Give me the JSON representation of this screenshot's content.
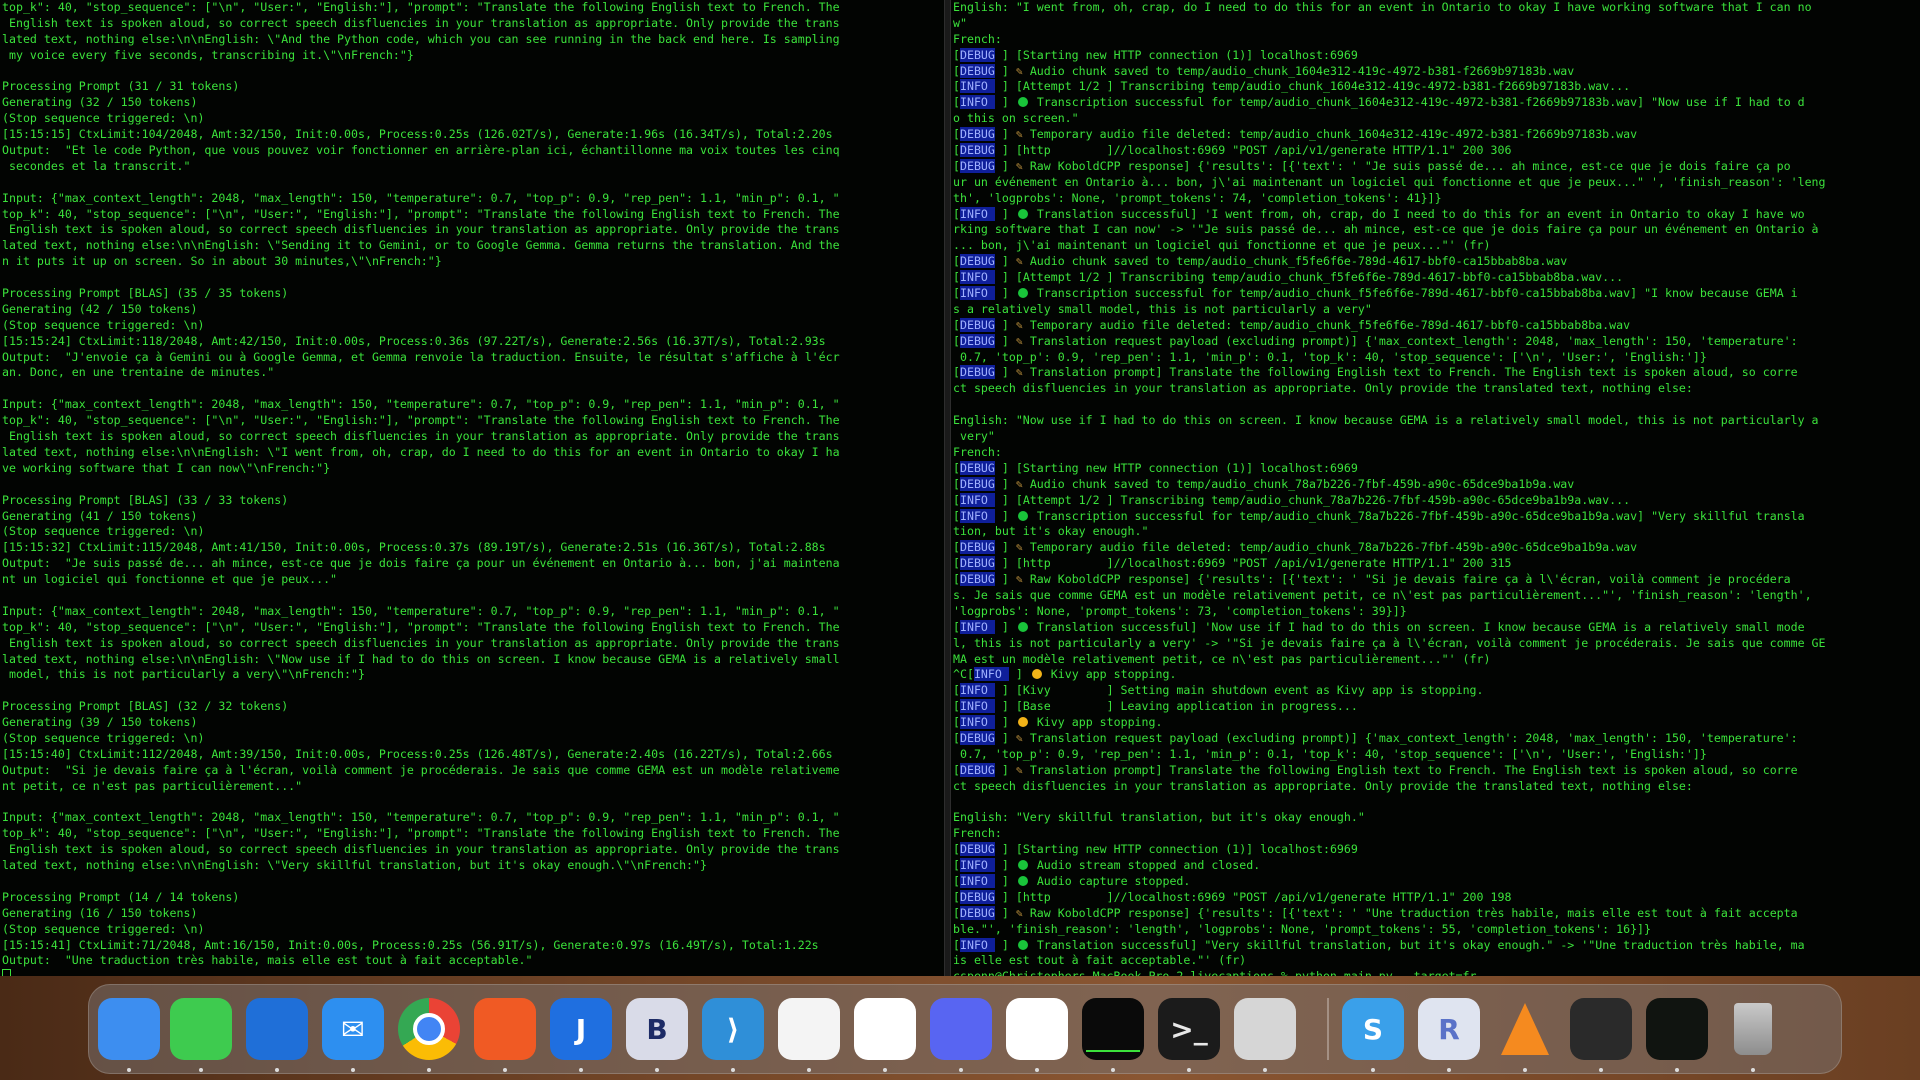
{
  "left_terminal": {
    "lines": [
      "top_k\": 40, \"stop_sequence\": [\"\\n\", \"User:\", \"English:\"], \"prompt\": \"Translate the following English text to French. The",
      " English text is spoken aloud, so correct speech disfluencies in your translation as appropriate. Only provide the trans",
      "lated text, nothing else:\\n\\nEnglish: \\\"And the Python code, which you can see running in the back end here. Is sampling",
      " my voice every five seconds, transcribing it.\\\"\\nFrench:\"}",
      "",
      "Processing Prompt (31 / 31 tokens)",
      "Generating (32 / 150 tokens)",
      "(Stop sequence triggered: \\n)",
      "[15:15:15] CtxLimit:104/2048, Amt:32/150, Init:0.00s, Process:0.25s (126.02T/s), Generate:1.96s (16.34T/s), Total:2.20s",
      "Output:  \"Et le code Python, que vous pouvez voir fonctionner en arrière-plan ici, échantillonne ma voix toutes les cinq",
      " secondes et la transcrit.\"",
      "",
      "Input: {\"max_context_length\": 2048, \"max_length\": 150, \"temperature\": 0.7, \"top_p\": 0.9, \"rep_pen\": 1.1, \"min_p\": 0.1, \"",
      "top_k\": 40, \"stop_sequence\": [\"\\n\", \"User:\", \"English:\"], \"prompt\": \"Translate the following English text to French. The",
      " English text is spoken aloud, so correct speech disfluencies in your translation as appropriate. Only provide the trans",
      "lated text, nothing else:\\n\\nEnglish: \\\"Sending it to Gemini, or to Google Gemma. Gemma returns the translation. And the",
      "n it puts it up on screen. So in about 30 minutes,\\\"\\nFrench:\"}",
      "",
      "Processing Prompt [BLAS] (35 / 35 tokens)",
      "Generating (42 / 150 tokens)",
      "(Stop sequence triggered: \\n)",
      "[15:15:24] CtxLimit:118/2048, Amt:42/150, Init:0.00s, Process:0.36s (97.22T/s), Generate:2.56s (16.37T/s), Total:2.93s",
      "Output:  \"J'envoie ça à Gemini ou à Google Gemma, et Gemma renvoie la traduction. Ensuite, le résultat s'affiche à l'écr",
      "an. Donc, en une trentaine de minutes.\"",
      "",
      "Input: {\"max_context_length\": 2048, \"max_length\": 150, \"temperature\": 0.7, \"top_p\": 0.9, \"rep_pen\": 1.1, \"min_p\": 0.1, \"",
      "top_k\": 40, \"stop_sequence\": [\"\\n\", \"User:\", \"English:\"], \"prompt\": \"Translate the following English text to French. The",
      " English text is spoken aloud, so correct speech disfluencies in your translation as appropriate. Only provide the trans",
      "lated text, nothing else:\\n\\nEnglish: \\\"I went from, oh, crap, do I need to do this for an event in Ontario to okay I ha",
      "ve working software that I can now\\\"\\nFrench:\"}",
      "",
      "Processing Prompt [BLAS] (33 / 33 tokens)",
      "Generating (41 / 150 tokens)",
      "(Stop sequence triggered: \\n)",
      "[15:15:32] CtxLimit:115/2048, Amt:41/150, Init:0.00s, Process:0.37s (89.19T/s), Generate:2.51s (16.36T/s), Total:2.88s",
      "Output:  \"Je suis passé de... ah mince, est-ce que je dois faire ça pour un événement en Ontario à... bon, j'ai maintena",
      "nt un logiciel qui fonctionne et que je peux...\"",
      "",
      "Input: {\"max_context_length\": 2048, \"max_length\": 150, \"temperature\": 0.7, \"top_p\": 0.9, \"rep_pen\": 1.1, \"min_p\": 0.1, \"",
      "top_k\": 40, \"stop_sequence\": [\"\\n\", \"User:\", \"English:\"], \"prompt\": \"Translate the following English text to French. The",
      " English text is spoken aloud, so correct speech disfluencies in your translation as appropriate. Only provide the trans",
      "lated text, nothing else:\\n\\nEnglish: \\\"Now use if I had to do this on screen. I know because GEMA is a relatively small",
      " model, this is not particularly a very\\\"\\nFrench:\"}",
      "",
      "Processing Prompt [BLAS] (32 / 32 tokens)",
      "Generating (39 / 150 tokens)",
      "(Stop sequence triggered: \\n)",
      "[15:15:40] CtxLimit:112/2048, Amt:39/150, Init:0.00s, Process:0.25s (126.48T/s), Generate:2.40s (16.22T/s), Total:2.66s",
      "Output:  \"Si je devais faire ça à l'écran, voilà comment je procéderais. Je sais que comme GEMA est un modèle relativeme",
      "nt petit, ce n'est pas particulièrement...\"",
      "",
      "Input: {\"max_context_length\": 2048, \"max_length\": 150, \"temperature\": 0.7, \"top_p\": 0.9, \"rep_pen\": 1.1, \"min_p\": 0.1, \"",
      "top_k\": 40, \"stop_sequence\": [\"\\n\", \"User:\", \"English:\"], \"prompt\": \"Translate the following English text to French. The",
      " English text is spoken aloud, so correct speech disfluencies in your translation as appropriate. Only provide the trans",
      "lated text, nothing else:\\n\\nEnglish: \\\"Very skillful translation, but it's okay enough.\\\"\\nFrench:\"}",
      "",
      "Processing Prompt (14 / 14 tokens)",
      "Generating (16 / 150 tokens)",
      "(Stop sequence triggered: \\n)",
      "[15:15:41] CtxLimit:71/2048, Amt:16/150, Init:0.00s, Process:0.25s (56.91T/s), Generate:0.97s (16.49T/s), Total:1.22s",
      "Output:  \"Une traduction très habile, mais elle est tout à fait acceptable.\""
    ]
  },
  "right_terminal": {
    "lines": [
      {
        "text": "English: \"I went from, oh, crap, do I need to do this for an event in Ontario to okay I have working software that I can no"
      },
      {
        "text": "w\""
      },
      {
        "text": "French:"
      },
      {
        "tag": "DEBUG",
        "text": "[Starting new HTTP connection (1)] localhost:6969"
      },
      {
        "tag": "DEBUG",
        "icon": "pen",
        "text": "Audio chunk saved to temp/audio_chunk_1604e312-419c-4972-b381-f2669b97183b.wav"
      },
      {
        "tag": "INFO ",
        "text": "[Attempt 1/2 ] Transcribing temp/audio_chunk_1604e312-419c-4972-b381-f2669b97183b.wav..."
      },
      {
        "tag": "INFO ",
        "icon": "green",
        "text": "Transcription successful for temp/audio_chunk_1604e312-419c-4972-b381-f2669b97183b.wav] \"Now use if I had to d"
      },
      {
        "text": "o this on screen.\""
      },
      {
        "tag": "DEBUG",
        "icon": "pen",
        "text": "Temporary audio file deleted: temp/audio_chunk_1604e312-419c-4972-b381-f2669b97183b.wav"
      },
      {
        "tag": "DEBUG",
        "text": "[http        ]//localhost:6969 \"POST /api/v1/generate HTTP/1.1\" 200 306"
      },
      {
        "tag": "DEBUG",
        "icon": "pen",
        "text": "Raw KoboldCPP response] {'results': [{'text': ' \"Je suis passé de... ah mince, est-ce que je dois faire ça po"
      },
      {
        "text": "ur un événement en Ontario à... bon, j\\'ai maintenant un logiciel qui fonctionne et que je peux...\" ', 'finish_reason': 'leng"
      },
      {
        "text": "th', 'logprobs': None, 'prompt_tokens': 74, 'completion_tokens': 41}]}"
      },
      {
        "tag": "INFO ",
        "icon": "green",
        "text": "Translation successful] 'I went from, oh, crap, do I need to do this for an event in Ontario to okay I have wo"
      },
      {
        "text": "rking software that I can now' -> '\"Je suis passé de... ah mince, est-ce que je dois faire ça pour un événement en Ontario à"
      },
      {
        "text": "... bon, j\\'ai maintenant un logiciel qui fonctionne et que je peux...\"' (fr)"
      },
      {
        "tag": "DEBUG",
        "icon": "pen",
        "text": "Audio chunk saved to temp/audio_chunk_f5fe6f6e-789d-4617-bbf0-ca15bbab8ba.wav"
      },
      {
        "tag": "INFO ",
        "text": "[Attempt 1/2 ] Transcribing temp/audio_chunk_f5fe6f6e-789d-4617-bbf0-ca15bbab8ba.wav..."
      },
      {
        "tag": "INFO ",
        "icon": "green",
        "text": "Transcription successful for temp/audio_chunk_f5fe6f6e-789d-4617-bbf0-ca15bbab8ba.wav] \"I know because GEMA i"
      },
      {
        "text": "s a relatively small model, this is not particularly a very\""
      },
      {
        "tag": "DEBUG",
        "icon": "pen",
        "text": "Temporary audio file deleted: temp/audio_chunk_f5fe6f6e-789d-4617-bbf0-ca15bbab8ba.wav"
      },
      {
        "tag": "DEBUG",
        "icon": "pen",
        "text": "Translation request payload (excluding prompt)] {'max_context_length': 2048, 'max_length': 150, 'temperature':"
      },
      {
        "text": " 0.7, 'top_p': 0.9, 'rep_pen': 1.1, 'min_p': 0.1, 'top_k': 40, 'stop_sequence': ['\\n', 'User:', 'English:']}"
      },
      {
        "tag": "DEBUG",
        "icon": "pen",
        "text": "Translation prompt] Translate the following English text to French. The English text is spoken aloud, so corre"
      },
      {
        "text": "ct speech disfluencies in your translation as appropriate. Only provide the translated text, nothing else:"
      },
      {
        "text": ""
      },
      {
        "text": "English: \"Now use if I had to do this on screen. I know because GEMA is a relatively small model, this is not particularly a"
      },
      {
        "text": " very\""
      },
      {
        "text": "French:"
      },
      {
        "tag": "DEBUG",
        "text": "[Starting new HTTP connection (1)] localhost:6969"
      },
      {
        "tag": "DEBUG",
        "icon": "pen",
        "text": "Audio chunk saved to temp/audio_chunk_78a7b226-7fbf-459b-a90c-65dce9ba1b9a.wav"
      },
      {
        "tag": "INFO ",
        "text": "[Attempt 1/2 ] Transcribing temp/audio_chunk_78a7b226-7fbf-459b-a90c-65dce9ba1b9a.wav..."
      },
      {
        "tag": "INFO ",
        "icon": "green",
        "text": "Transcription successful for temp/audio_chunk_78a7b226-7fbf-459b-a90c-65dce9ba1b9a.wav] \"Very skillful transla"
      },
      {
        "text": "tion, but it's okay enough.\""
      },
      {
        "tag": "DEBUG",
        "icon": "pen",
        "text": "Temporary audio file deleted: temp/audio_chunk_78a7b226-7fbf-459b-a90c-65dce9ba1b9a.wav"
      },
      {
        "tag": "DEBUG",
        "text": "[http        ]//localhost:6969 \"POST /api/v1/generate HTTP/1.1\" 200 315"
      },
      {
        "tag": "DEBUG",
        "icon": "pen",
        "text": "Raw KoboldCPP response] {'results': [{'text': ' \"Si je devais faire ça à l\\'écran, voilà comment je procédera"
      },
      {
        "text": "s. Je sais que comme GEMA est un modèle relativement petit, ce n\\'est pas particulièrement...\"', 'finish_reason': 'length',"
      },
      {
        "text": "'logprobs': None, 'prompt_tokens': 73, 'completion_tokens': 39}]}"
      },
      {
        "tag": "INFO ",
        "icon": "green",
        "text": "Translation successful] 'Now use if I had to do this on screen. I know because GEMA is a relatively small mode"
      },
      {
        "text": "l, this is not particularly a very' -> '\"Si je devais faire ça à l\\'écran, voilà comment je procéderais. Je sais que comme GE"
      },
      {
        "text": "MA est un modèle relativement petit, ce n\\'est pas particulièrement...\"' (fr)"
      },
      {
        "prefix": "^C",
        "tag": "INFO ",
        "icon": "yellow",
        "text": "Kivy app stopping."
      },
      {
        "tag": "INFO ",
        "text": "[Kivy        ] Setting main shutdown event as Kivy app is stopping."
      },
      {
        "tag": "INFO ",
        "text": "[Base        ] Leaving application in progress..."
      },
      {
        "tag": "INFO ",
        "icon": "yellow",
        "text": "Kivy app stopping."
      },
      {
        "tag": "DEBUG",
        "icon": "pen",
        "text": "Translation request payload (excluding prompt)] {'max_context_length': 2048, 'max_length': 150, 'temperature':"
      },
      {
        "text": " 0.7, 'top_p': 0.9, 'rep_pen': 1.1, 'min_p': 0.1, 'top_k': 40, 'stop_sequence': ['\\n', 'User:', 'English:']}"
      },
      {
        "tag": "DEBUG",
        "icon": "pen",
        "text": "Translation prompt] Translate the following English text to French. The English text is spoken aloud, so corre"
      },
      {
        "text": "ct speech disfluencies in your translation as appropriate. Only provide the translated text, nothing else:"
      },
      {
        "text": ""
      },
      {
        "text": "English: \"Very skillful translation, but it's okay enough.\""
      },
      {
        "text": "French:"
      },
      {
        "tag": "DEBUG",
        "text": "[Starting new HTTP connection (1)] localhost:6969"
      },
      {
        "tag": "INFO ",
        "icon": "green",
        "text": "Audio stream stopped and closed."
      },
      {
        "tag": "INFO ",
        "icon": "green",
        "text": "Audio capture stopped."
      },
      {
        "tag": "DEBUG",
        "text": "[http        ]//localhost:6969 \"POST /api/v1/generate HTTP/1.1\" 200 198"
      },
      {
        "tag": "DEBUG",
        "icon": "pen",
        "text": "Raw KoboldCPP response] {'results': [{'text': ' \"Une traduction très habile, mais elle est tout à fait accepta"
      },
      {
        "text": "ble.\"', 'finish_reason': 'length', 'logprobs': None, 'prompt_tokens': 55, 'completion_tokens': 16}]}"
      },
      {
        "tag": "INFO ",
        "icon": "green",
        "text": "Translation successful] \"Very skillful translation, but it's okay enough.\" -> '\"Une traduction très habile, ma"
      },
      {
        "text": "is elle est tout à fait acceptable.\"' (fr)"
      },
      {
        "text": "cspenn@Christophers-MacBook-Pro-2 livecaptions % python main.py --target=fr"
      }
    ]
  },
  "dock": {
    "items": [
      {
        "name": "finder-icon",
        "label": "",
        "bg": "#3d8ef0",
        "fg": "#ffffff"
      },
      {
        "name": "messages-icon",
        "label": "",
        "bg": "#3ecb4f",
        "fg": "#ffffff"
      },
      {
        "name": "thunderbird-icon",
        "label": "",
        "bg": "#1f6fd8",
        "fg": "#ffffff"
      },
      {
        "name": "mail-icon",
        "label": "✉",
        "bg": "#2d8ff0",
        "fg": "#ffffff"
      },
      {
        "name": "chrome-icon",
        "label": "",
        "bg": "#f2f2f2",
        "fg": "#ffffff"
      },
      {
        "name": "brave-icon",
        "label": "",
        "bg": "#f05a24",
        "fg": "#ffffff"
      },
      {
        "name": "joplin-icon",
        "label": "J",
        "bg": "#1f6fe0",
        "fg": "#ffffff"
      },
      {
        "name": "bbedit-icon",
        "label": "B",
        "bg": "#d9dbe8",
        "fg": "#1d2b66"
      },
      {
        "name": "vscode-icon",
        "label": "⟩",
        "bg": "#2f8fd8",
        "fg": "#ffffff"
      },
      {
        "name": "arc-icon",
        "label": "",
        "bg": "#f4f4f4",
        "fg": "#2d5fe0"
      },
      {
        "name": "slack-icon",
        "label": "",
        "bg": "#ffffff",
        "fg": "#4a154b"
      },
      {
        "name": "discord-icon",
        "label": "",
        "bg": "#5865f2",
        "fg": "#ffffff"
      },
      {
        "name": "asana-icon",
        "label": "",
        "bg": "#ffffff",
        "fg": "#f06a6a"
      },
      {
        "name": "activity-monitor-icon",
        "label": "",
        "bg": "#0a0a0a",
        "fg": "#3be23b"
      },
      {
        "name": "terminal-icon",
        "label": ">_",
        "bg": "#1b1b1b",
        "fg": "#e8e8e8"
      },
      {
        "name": "iphone-mirroring-icon",
        "label": "",
        "bg": "#d6d6d6",
        "fg": "#ffffff"
      },
      {
        "name": "scrivener-icon",
        "label": "S",
        "bg": "#3aa0ea",
        "fg": "#ffffff"
      },
      {
        "name": "r-icon",
        "label": "R",
        "bg": "#dfe4f0",
        "fg": "#5a72c8"
      },
      {
        "name": "vlc-icon",
        "label": "",
        "bg": "transparent",
        "fg": "#f58a1f"
      },
      {
        "name": "minimized-window-1-icon",
        "label": "",
        "bg": "#2a2a2a",
        "fg": "#3be23b"
      },
      {
        "name": "minimized-window-2-icon",
        "label": "",
        "bg": "#101410",
        "fg": "#3be23b"
      },
      {
        "name": "trash-icon",
        "label": "",
        "bg": "transparent",
        "fg": "#9a9a9a"
      }
    ]
  }
}
